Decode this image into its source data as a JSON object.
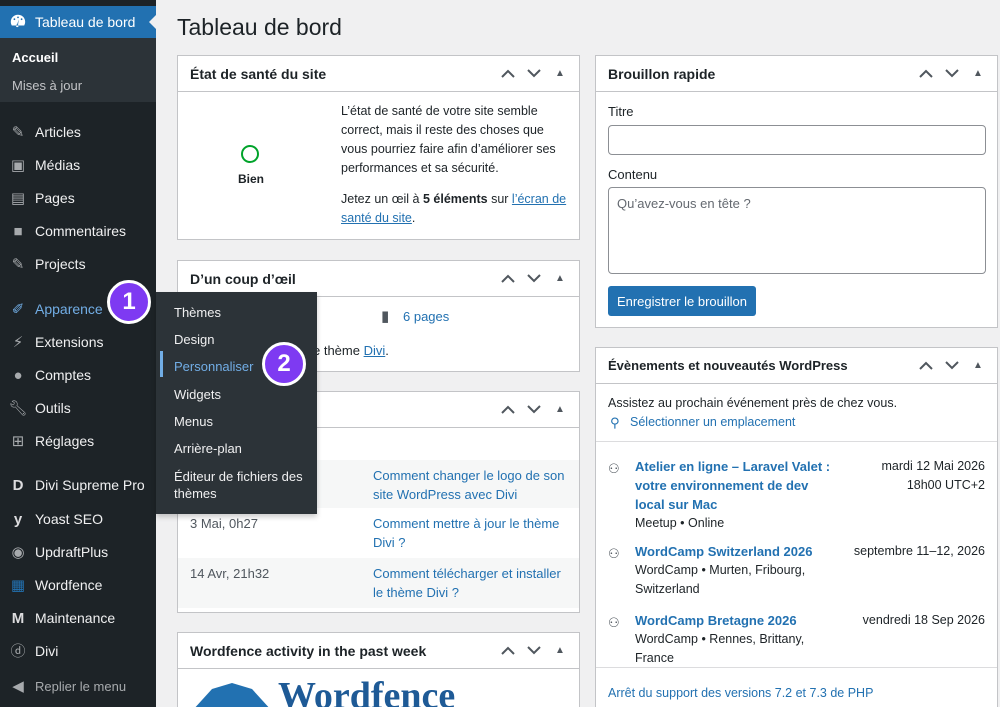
{
  "sidebar": {
    "dashboard": {
      "label": "Tableau de bord",
      "icon": "dashboard-icon"
    },
    "dashboard_sub": [
      {
        "label": "Accueil"
      },
      {
        "label": "Mises à jour"
      }
    ],
    "items": [
      {
        "label": "Articles",
        "icon": "pin-icon"
      },
      {
        "label": "Médias",
        "icon": "media-icon"
      },
      {
        "label": "Pages",
        "icon": "page-icon"
      },
      {
        "label": "Commentaires",
        "icon": "comment-icon"
      },
      {
        "label": "Projects",
        "icon": "pin-icon"
      },
      {
        "label": "Apparence",
        "icon": "brush-icon"
      },
      {
        "label": "Extensions",
        "icon": "plugin-icon"
      },
      {
        "label": "Comptes",
        "icon": "user-icon"
      },
      {
        "label": "Outils",
        "icon": "wrench-icon"
      },
      {
        "label": "Réglages",
        "icon": "settings-icon"
      },
      {
        "label": "Divi Supreme Pro",
        "icon": "divi-supreme-icon"
      },
      {
        "label": "Yoast SEO",
        "icon": "yoast-icon"
      },
      {
        "label": "UpdraftPlus",
        "icon": "updraft-icon"
      },
      {
        "label": "Wordfence",
        "icon": "wordfence-icon"
      },
      {
        "label": "Maintenance",
        "icon": "maintenance-icon"
      },
      {
        "label": "Divi",
        "icon": "divi-icon"
      }
    ],
    "collapse": {
      "label": "Replier le menu",
      "icon": "collapse-icon"
    }
  },
  "flyout": {
    "items": [
      {
        "label": "Thèmes"
      },
      {
        "label": "Design"
      },
      {
        "label": "Personnaliser"
      },
      {
        "label": "Widgets"
      },
      {
        "label": "Menus"
      },
      {
        "label": "Arrière-plan"
      },
      {
        "label": "Éditeur de fichiers des thèmes"
      }
    ]
  },
  "badges": {
    "one": "1",
    "two": "2",
    "color": "#7e3af2"
  },
  "page_title": "Tableau de bord",
  "site_health": {
    "title": "État de santé du site",
    "status": "Bien",
    "text1": "L’état de santé de votre site semble correct, mais il reste des choses que vous pourriez faire afin d’améliorer ses performances et sa sécurité.",
    "text2_a": "Jetez un œil à ",
    "text2_b": "5 éléments",
    "text2_c": " sur ",
    "text2_link": "l’écran de santé du site",
    "text2_d": "."
  },
  "glance": {
    "title": "D’un coup d’œil",
    "pages": "6 pages",
    "theme_a": "e thème ",
    "theme_link": "Divi",
    "theme_b": "."
  },
  "activity": {
    "posts": [
      {
        "link": "Comment changer le logo de son site WordPress avec Divi"
      },
      {
        "date": "3 Mai, 0h27",
        "link": "Comment mettre à jour le thème Divi ?"
      },
      {
        "date": "14 Avr, 21h32",
        "link": "Comment télécharger et installer le thème Divi ?"
      }
    ]
  },
  "wordfence": {
    "title": "Wordfence activity in the past week",
    "logo_text": "Wordfence"
  },
  "quick_draft": {
    "title": "Brouillon rapide",
    "title_label": "Titre",
    "content_label": "Contenu",
    "content_placeholder": "Qu’avez-vous en tête ?",
    "save_label": "Enregistrer le brouillon"
  },
  "events": {
    "title": "Évènements et nouveautés WordPress",
    "intro": "Assistez au prochain événement près de chez vous.",
    "location_link": "Sélectionner un emplacement",
    "items": [
      {
        "title": "Atelier en ligne – Laravel Valet : votre environnement de dev local sur Mac",
        "meta": "Meetup • Online",
        "date": "mardi 12 Mai 2026",
        "time": "18h00 UTC+2"
      },
      {
        "title": "WordCamp Switzerland 2026",
        "meta": "WordCamp • Murten, Fribourg, Switzerland",
        "date": "septembre 11–12, 2026"
      },
      {
        "title": "WordCamp Bretagne 2026",
        "meta": "WordCamp • Rennes, Brittany, France",
        "date": "vendredi 18 Sep 2026"
      }
    ],
    "news_link": "Arrêt du support des versions 7.2 et 7.3 de PHP"
  }
}
